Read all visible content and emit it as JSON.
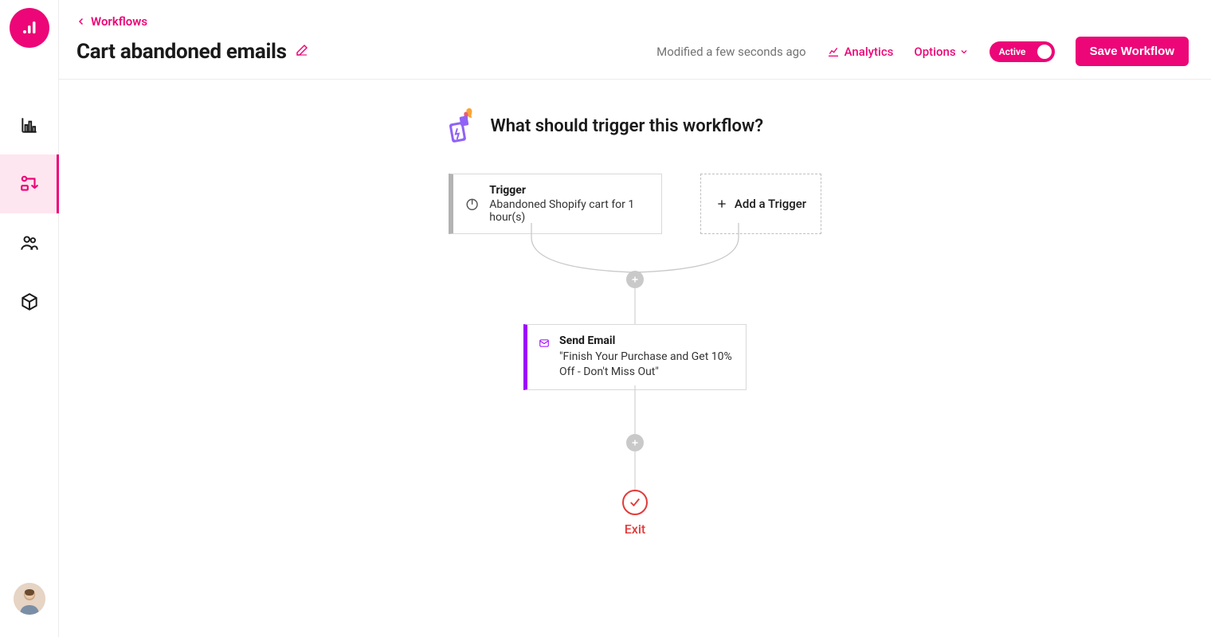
{
  "breadcrumb": {
    "back_label": "Workflows"
  },
  "header": {
    "title": "Cart abandoned emails",
    "modified": "Modified a few seconds ago",
    "analytics_label": "Analytics",
    "options_label": "Options",
    "toggle_label": "Active",
    "save_label": "Save Workflow"
  },
  "canvas": {
    "trigger_prompt": "What should trigger this workflow?",
    "trigger_card": {
      "title": "Trigger",
      "subtitle": "Abandoned Shopify cart for 1 hour(s)"
    },
    "add_trigger_label": "Add a Trigger",
    "action_card": {
      "title": "Send Email",
      "subtitle": "\"Finish Your Purchase and Get 10% Off - Don't Miss Out\""
    },
    "exit_label": "Exit"
  },
  "colors": {
    "brand": "#ec0677",
    "purple": "#9e00ff",
    "danger": "#e23b3b"
  }
}
